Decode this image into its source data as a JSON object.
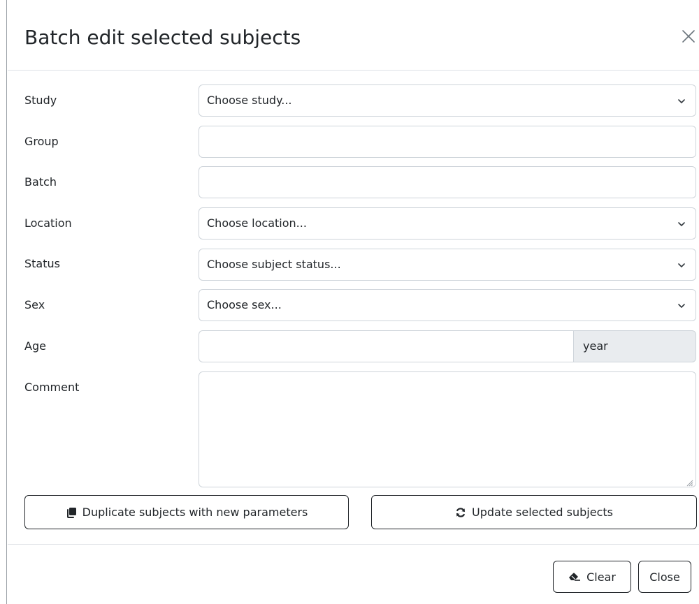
{
  "dialog": {
    "title": "Batch edit selected subjects"
  },
  "form": {
    "study": {
      "label": "Study",
      "value": "Choose study..."
    },
    "group": {
      "label": "Group",
      "value": ""
    },
    "batch": {
      "label": "Batch",
      "value": ""
    },
    "location": {
      "label": "Location",
      "value": "Choose location..."
    },
    "status": {
      "label": "Status",
      "value": "Choose subject status..."
    },
    "sex": {
      "label": "Sex",
      "value": "Choose sex..."
    },
    "age": {
      "label": "Age",
      "value": "",
      "unit": "year"
    },
    "comment": {
      "label": "Comment",
      "value": ""
    }
  },
  "actions": {
    "duplicate_label": "Duplicate subjects with new parameters",
    "update_label": "Update selected subjects"
  },
  "footer": {
    "clear_label": "Clear",
    "close_label": "Close"
  },
  "icons": {
    "close": "close-icon",
    "chevron": "chevron-down-icon",
    "copy": "copy-icon",
    "refresh": "refresh-icon",
    "eraser": "eraser-icon"
  },
  "colors": {
    "border": "#ced4da",
    "button_border": "#212529",
    "addon_bg": "#e9ecef",
    "divider": "#dee2e6",
    "text": "#212529"
  }
}
